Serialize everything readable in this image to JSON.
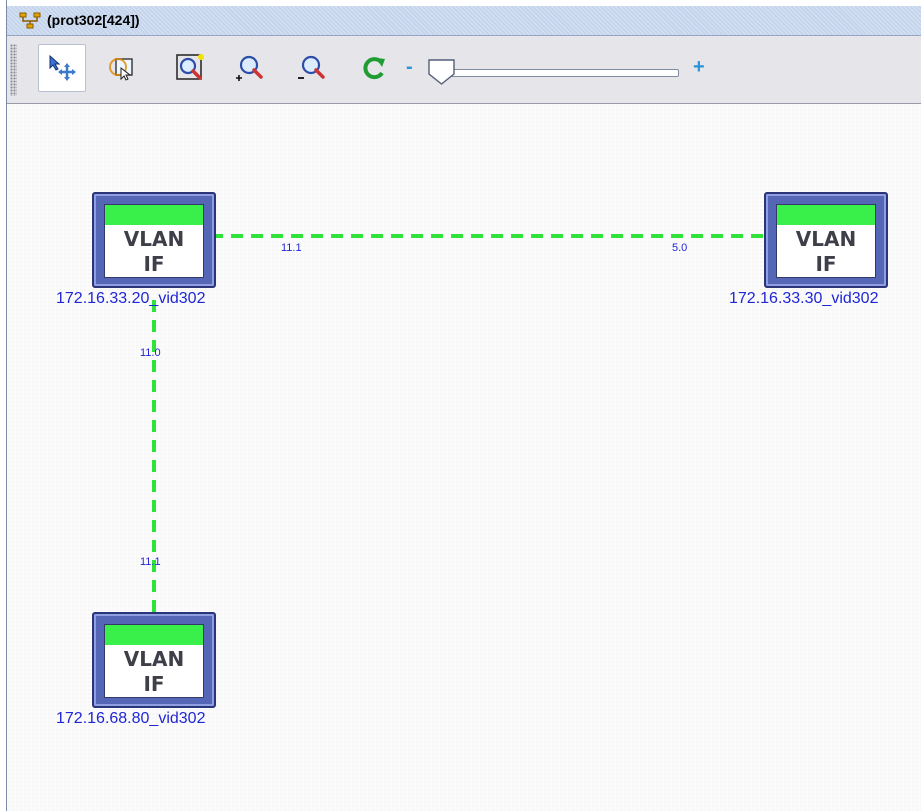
{
  "window": {
    "title": "(prot302[424])"
  },
  "toolbar": {
    "buttons": [
      {
        "name": "select-move-tool",
        "icon": "pointer-move-icon",
        "active": true
      },
      {
        "name": "select-area-tool",
        "icon": "rectangle-select-icon",
        "active": false
      },
      {
        "name": "zoom-fit-tool",
        "icon": "zoom-fit-icon",
        "active": false
      },
      {
        "name": "zoom-in-tool",
        "icon": "zoom-in-icon",
        "active": false
      },
      {
        "name": "zoom-out-tool",
        "icon": "zoom-out-icon",
        "active": false
      },
      {
        "name": "refresh-tool",
        "icon": "refresh-icon",
        "active": false
      }
    ],
    "zoom_minus_label": "-",
    "zoom_plus_label": "+",
    "zoom_level": 0.05
  },
  "colors": {
    "link": "#2ee33a",
    "label": "#1f26d6",
    "status_ok": "#39f04b",
    "node_border": "#5666b6"
  },
  "nodes": [
    {
      "id": "n1",
      "type": "VLAN\nIF",
      "label": "172.16.33.20_vid302",
      "status": "up"
    },
    {
      "id": "n2",
      "type": "VLAN\nIF",
      "label": "172.16.33.30_vid302",
      "status": "up"
    },
    {
      "id": "n3",
      "type": "VLAN\nIF",
      "label": "172.16.68.80_vid302",
      "status": "up"
    }
  ],
  "links": [
    {
      "from": "n1",
      "to": "n2",
      "from_label": "11.1",
      "to_label": "5.0"
    },
    {
      "from": "n1",
      "to": "n3",
      "from_label": "11.0",
      "to_label": "11.1"
    }
  ]
}
